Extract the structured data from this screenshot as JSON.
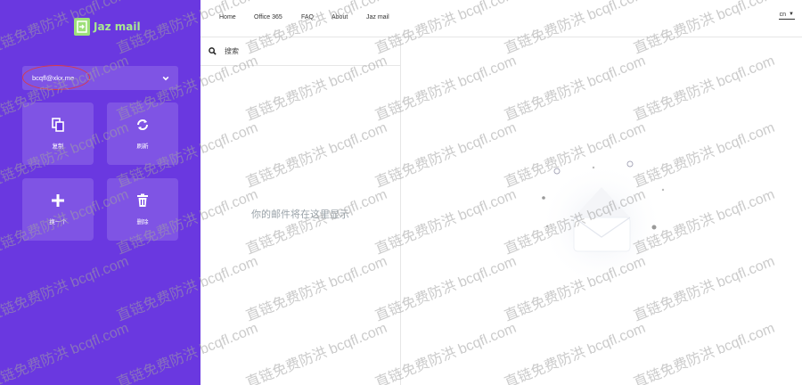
{
  "app": {
    "name": "Jaz mail"
  },
  "sidebar": {
    "email": "bcqfl@xkx.me",
    "actions": [
      {
        "label": "复制",
        "icon": "copy-icon"
      },
      {
        "label": "刷新",
        "icon": "refresh-icon"
      },
      {
        "label": "换一个",
        "icon": "plus-icon"
      },
      {
        "label": "删除",
        "icon": "trash-icon"
      }
    ]
  },
  "nav": {
    "items": [
      "Home",
      "Office 365",
      "FAQ",
      "About",
      "Jaz mail"
    ],
    "lang": "cn"
  },
  "list": {
    "search_placeholder": "搜索",
    "empty_message": "你的邮件将在这里显示"
  },
  "watermark": {
    "text": "直链免费防洪 bcqfl.com"
  },
  "colors": {
    "sidebar": "#6a38e0",
    "accent": "#9ee07a",
    "highlight_oval": "#d93a4a"
  }
}
